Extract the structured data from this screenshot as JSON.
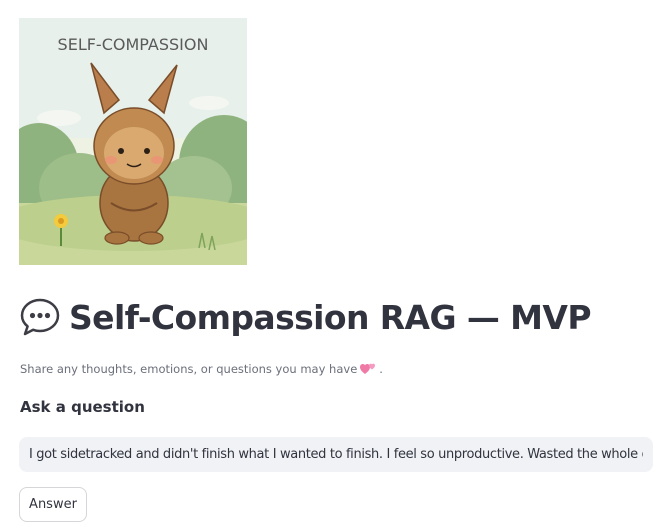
{
  "hero": {
    "image_text": "SELF-COMPASSION",
    "image_description": "creature-icon"
  },
  "header": {
    "icon": "speech-bubble-icon",
    "title": "Self-Compassion RAG — MVP"
  },
  "subtitle": {
    "text": "Share any thoughts, emotions, or questions you may have",
    "suffix": ".",
    "icon": "two-hearts-icon"
  },
  "question": {
    "label": "Ask a question",
    "value": "I got sidetracked and didn't finish what I wanted to finish. I feel so unproductive. Wasted the whole day."
  },
  "actions": {
    "answer_label": "Answer"
  },
  "colors": {
    "text": "#31333f",
    "muted": "#6b6f7b",
    "input_bg": "#f0f2f6",
    "button_border": "#d6d6d9",
    "heart": "#f07aa6"
  }
}
